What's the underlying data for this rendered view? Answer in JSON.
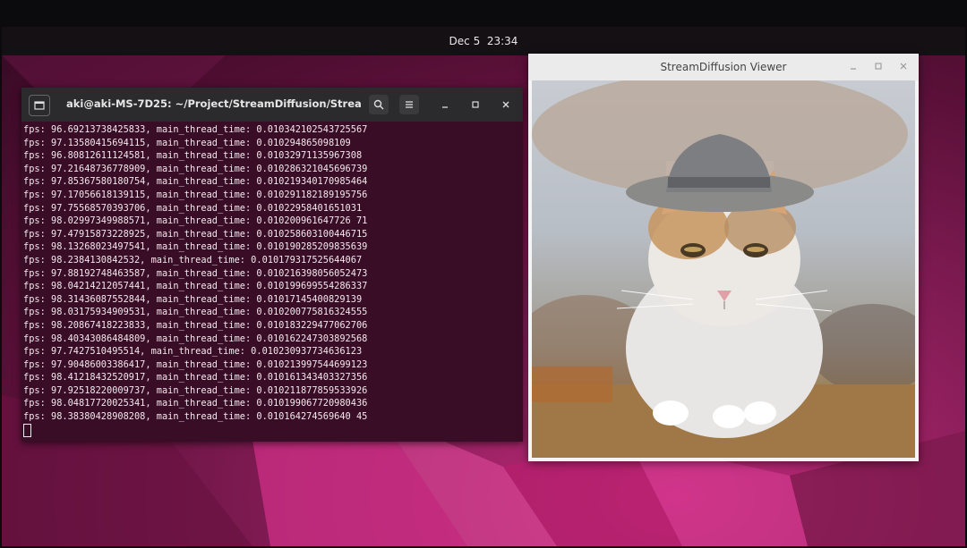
{
  "topbar": {
    "datetime": "Dec 5  23:34"
  },
  "terminal": {
    "title": "aki@aki-MS-7D25: ~/Project/StreamDiffusion/Strea...",
    "lines": [
      "fps: 96.69213738425833, main_thread_time: 0.010342102543725567",
      "fps: 97.13580415694115, main_thread_time: 0.010294865098109",
      "fps: 96.80812611124581, main_thread_time: 0.01032971135967308",
      "fps: 97.21648736778909, main_thread_time: 0.010286321045696739",
      "fps: 97.85367580180754, main_thread_time: 0.010219340170985464",
      "fps: 97.17056618139115, main_thread_time: 0.010291182189195756",
      "fps: 97.75568570393706, main_thread_time: 0.01022958401651031",
      "fps: 98.02997349988571, main_thread_time: 0.010200961647726 71",
      "fps: 97.47915873228925, main_thread_time: 0.010258603100446715",
      "fps: 98.13268023497541, main_thread_time: 0.010190285209835639",
      "fps: 98.2384130842532, main_thread_time: 0.010179317525644067",
      "fps: 97.88192748463587, main_thread_time: 0.010216398056052473",
      "fps: 98.04214212057441, main_thread_time: 0.010199699554286337",
      "fps: 98.31436087552844, main_thread_time: 0.01017145400829139",
      "fps: 98.03175934909531, main_thread_time: 0.010200775816324555",
      "fps: 98.20867418223833, main_thread_time: 0.010183229477062706",
      "fps: 98.40343086484809, main_thread_time: 0.010162247303892568",
      "fps: 97.7427510495514, main_thread_time: 0.010230937734636123",
      "fps: 97.90486003386417, main_thread_time: 0.010213997544699123",
      "fps: 98.41218432520917, main_thread_time: 0.010161343403327356",
      "fps: 97.92518220009737, main_thread_time: 0.010211877859533926",
      "fps: 98.04817720025341, main_thread_time: 0.010199067720980436",
      "fps: 98.38380428908208, main_thread_time: 0.010164274569640 45"
    ],
    "icons": {
      "terminal": "terminal-icon",
      "search": "search-icon",
      "menu": "hamburger-icon",
      "minimize": "minimize-icon",
      "maximize": "maximize-icon",
      "close": "close-icon"
    }
  },
  "viewer": {
    "title": "StreamDiffusion Viewer",
    "image_subject": "cat wearing a hat",
    "icons": {
      "minimize": "minimize-icon",
      "maximize": "maximize-icon",
      "close": "close-icon"
    }
  },
  "colors": {
    "terminal_bg": "#3a0d26",
    "desktop_accent": "#c02a7a",
    "header_bg": "#2b2b2d"
  }
}
